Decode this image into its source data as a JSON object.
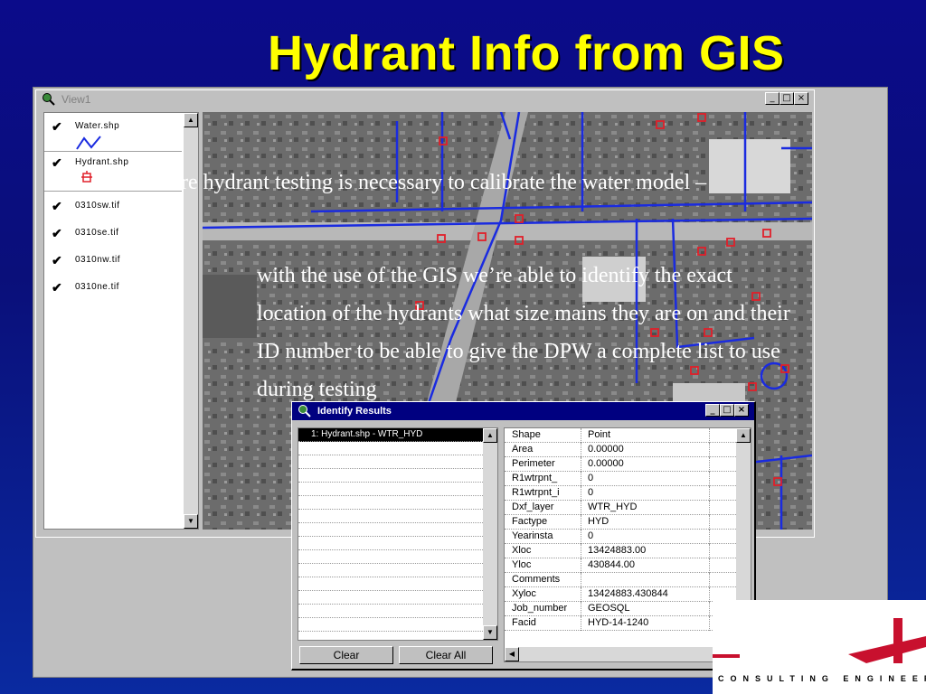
{
  "slide": {
    "title": "Hydrant Info from GIS"
  },
  "view_window": {
    "title": "View1",
    "controls": {
      "minimize": "_",
      "maximize": "□",
      "close": "×"
    },
    "layers": [
      {
        "label": "Water.shp",
        "checked": true,
        "legend": "blue-line-icon"
      },
      {
        "label": "Hydrant.shp",
        "checked": true,
        "legend": "hydrant-icon"
      },
      {
        "label": "0310sw.tif",
        "checked": true
      },
      {
        "label": "0310se.tif",
        "checked": true
      },
      {
        "label": "0310nw.tif",
        "checked": true
      },
      {
        "label": "0310ne.tif",
        "checked": true
      }
    ]
  },
  "identify_dialog": {
    "title": "Identify Results",
    "selected_result": "1: Hydrant.shp - WTR_HYD",
    "attributes": [
      {
        "key": "Shape",
        "value": "Point"
      },
      {
        "key": "Area",
        "value": "0.00000"
      },
      {
        "key": "Perimeter",
        "value": "0.00000"
      },
      {
        "key": "R1wtrpnt_",
        "value": "0"
      },
      {
        "key": "R1wtrpnt_i",
        "value": "0"
      },
      {
        "key": "Dxf_layer",
        "value": "WTR_HYD"
      },
      {
        "key": "Factype",
        "value": "HYD"
      },
      {
        "key": "Yearinsta",
        "value": "0"
      },
      {
        "key": "Xloc",
        "value": "13424883.00"
      },
      {
        "key": "Yloc",
        "value": "430844.00"
      },
      {
        "key": "Comments",
        "value": ""
      },
      {
        "key": "Xyloc",
        "value": "13424883.430844"
      },
      {
        "key": "Job_number",
        "value": "GEOSQL"
      },
      {
        "key": "Facid",
        "value": "HYD-14-1240"
      }
    ],
    "buttons": {
      "clear": "Clear",
      "clear_all": "Clear All"
    }
  },
  "overlay": {
    "line1": "Fire hydrant testing is necessary to calibrate the water model –",
    "line2": "with the use of the GIS we’re able to identify the exact location of the hydrants what size mains they are on and their ID number to be able to give the DPW a complete list to use during testing"
  },
  "logo": {
    "text": "CONSULTING ENGINEERS"
  },
  "colors": {
    "title": "#ffff00",
    "water_line": "#1a2be0",
    "hydrant": "#e0202a",
    "dialog_title": "#000080"
  }
}
